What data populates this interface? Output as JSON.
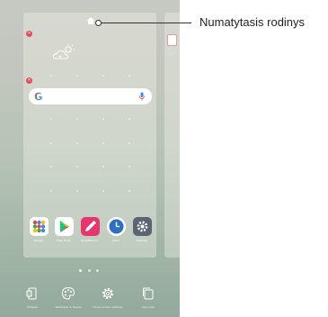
{
  "callout": {
    "text": "Numatytasis rodinys"
  },
  "home_panel": {
    "icons": [
      "home-icon",
      "remove-icon",
      "weather-cloud-icon",
      "google-logo-icon",
      "mic-icon"
    ],
    "dock_apps": [
      {
        "name": "Google",
        "icon": "google-folder-icon",
        "color": "#ffffff"
      },
      {
        "name": "Play Store",
        "icon": "play-store-icon",
        "color": "#ffffff"
      },
      {
        "name": "QuickMemo+",
        "icon": "quickmemo-icon",
        "color": "#e8356f"
      },
      {
        "name": "Clock",
        "icon": "clock-icon",
        "color": "#2e6fc1"
      },
      {
        "name": "Settings",
        "icon": "settings-icon",
        "color": "#5b6472"
      }
    ]
  },
  "bottom_bar": {
    "items": [
      {
        "label": "Widgets",
        "icon": "widgets-icon"
      },
      {
        "label": "Wallpaper & theme",
        "icon": "palette-icon"
      },
      {
        "label": "Home screen settings",
        "icon": "gear-icon"
      },
      {
        "label": "App trash",
        "icon": "app-trash-icon"
      }
    ]
  }
}
